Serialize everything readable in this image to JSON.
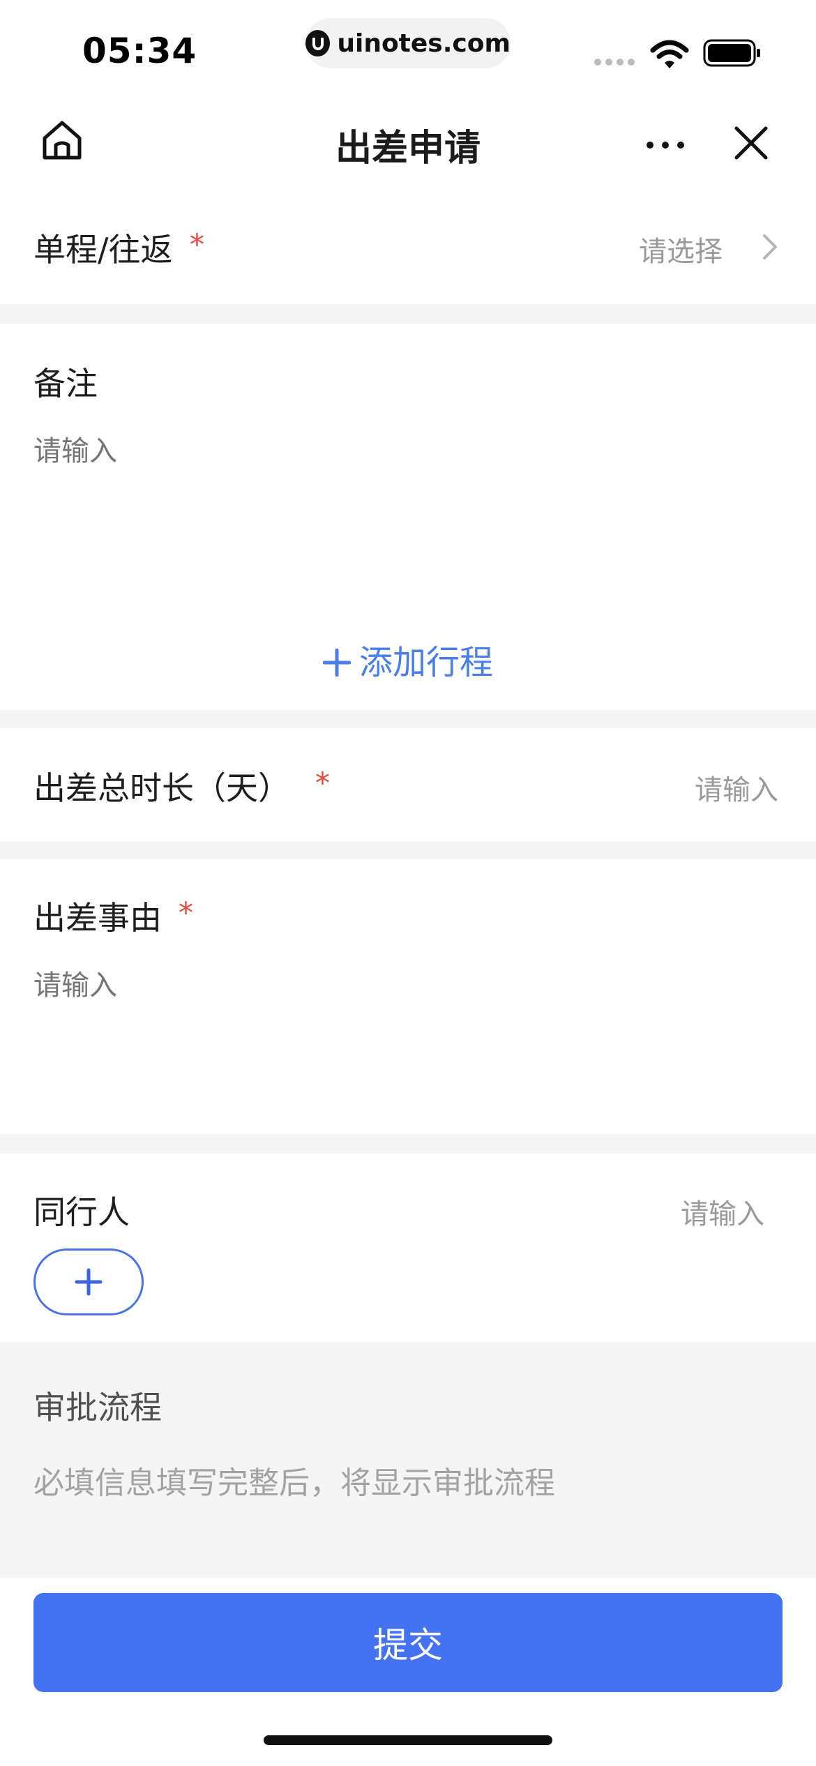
{
  "status_bar": {
    "time": "05:34",
    "url": "uinotes.com"
  },
  "nav": {
    "title": "出差申请",
    "home_icon": "home-icon",
    "more_icon": "more-icon",
    "close_icon": "close-icon"
  },
  "form": {
    "trip_type": {
      "label": "单程/往返",
      "required": "*",
      "placeholder": "请选择"
    },
    "remark": {
      "label": "备注",
      "placeholder": "请输入"
    },
    "add_trip": {
      "label": "添加行程"
    },
    "duration": {
      "label": "出差总时长（天）",
      "required": "*",
      "placeholder": "请输入"
    },
    "reason": {
      "label": "出差事由",
      "required": "*",
      "placeholder": "请输入"
    },
    "companions": {
      "label": "同行人",
      "placeholder": "请输入"
    }
  },
  "approval": {
    "title": "审批流程",
    "description": "必填信息填写完整后，将显示审批流程"
  },
  "submit": {
    "label": "提交"
  },
  "colors": {
    "primary": "#4472f1",
    "link": "#4a7ee8",
    "required": "#e5483e",
    "placeholder": "#9a9a9a",
    "separator": "#f5f5f5"
  }
}
